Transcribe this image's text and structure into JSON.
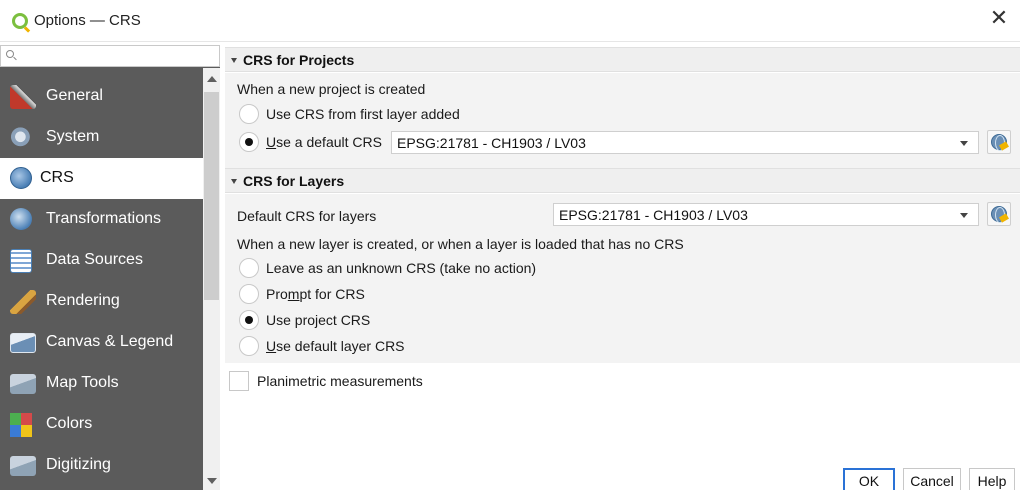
{
  "window": {
    "title": "Options — CRS",
    "close_glyph": "✕"
  },
  "sidebar": {
    "search_placeholder": "",
    "items": [
      {
        "label": "General",
        "icon": "tools-icon",
        "color": "#c0392b"
      },
      {
        "label": "System",
        "icon": "gears-icon",
        "color": "#8aa0b8"
      },
      {
        "label": "CRS",
        "icon": "globe-icon",
        "color": "#4a7fb5"
      },
      {
        "label": "Transformations",
        "icon": "globe-transform-icon",
        "color": "#4a7fb5"
      },
      {
        "label": "Data Sources",
        "icon": "table-icon",
        "color": "#7fa7d6"
      },
      {
        "label": "Rendering",
        "icon": "brush-icon",
        "color": "#d9a441"
      },
      {
        "label": "Canvas & Legend",
        "icon": "map-canvas-icon",
        "color": "#6b8fb5"
      },
      {
        "label": "Map Tools",
        "icon": "map-tools-icon",
        "color": "#8fa3b5"
      },
      {
        "label": "Colors",
        "icon": "color-grid-icon",
        "color": "#d44a4a"
      },
      {
        "label": "Digitizing",
        "icon": "digitizing-icon",
        "color": "#8fa3b5"
      }
    ],
    "selected_index": 2
  },
  "crs_projects": {
    "heading": "CRS for Projects",
    "intro": "When a new project is created",
    "option_first_layer": "Use CRS from first layer added",
    "option_default_prefix": "U",
    "option_default_rest": "se a default CRS",
    "default_crs_value": "EPSG:21781 - CH1903 / LV03",
    "selected": "default"
  },
  "crs_layers": {
    "heading": "CRS for Layers",
    "default_label": "Default CRS for layers",
    "default_crs_value": "EPSG:21781 - CH1903 / LV03",
    "intro": "When a new layer is created, or when a layer is loaded that has no CRS",
    "option_unknown": "Leave as an unknown CRS (take no action)",
    "option_prompt_a": "Pro",
    "option_prompt_u": "m",
    "option_prompt_b": "pt for CRS",
    "option_project": "Use project CRS",
    "option_default_u": "U",
    "option_default_rest": "se default layer CRS",
    "selected": "project"
  },
  "planimetric": {
    "label": "Planimetric measurements",
    "checked": false
  },
  "buttons": {
    "ok": "OK",
    "cancel": "Cancel",
    "help": "Help"
  }
}
